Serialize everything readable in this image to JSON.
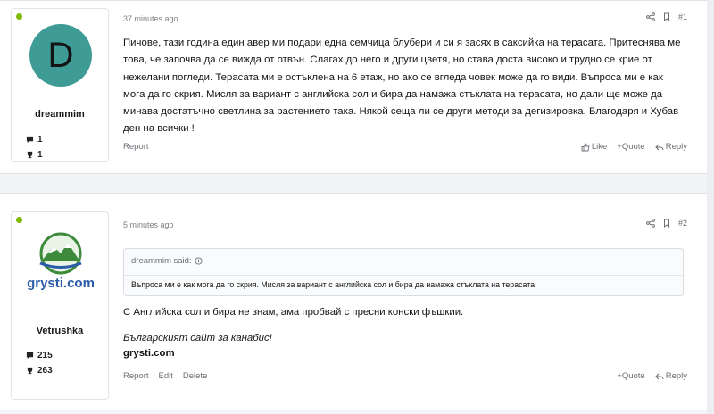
{
  "posts": [
    {
      "time": "37 minutes ago",
      "number": "#1",
      "user": {
        "avatar_letter": "D",
        "name": "dreammim",
        "messages": "1",
        "reactions": "1"
      },
      "body": "Пичове, тази година един авер ми подари една семчица блубери и си я засях в саксийка на терасата. Притеснява ме това, че започва да се вижда от отвън. Слагах до него и други цветя, но става доста високо и трудно се крие от нежелани погледи. Терасата ми е остъклена на 6 етаж, но ако се вгледа човек може да го види. Въпроса ми е как мога да го скрия. Мисля за вариант с английска сол и бира да намажа стъклата на терасата, но дали ще може да минава достатъчно светлина за растението така. Някой сеща ли се други методи за дегизировка. Благодаря и Хубав ден на всички !",
      "footer_left": [
        "Report"
      ],
      "actions": {
        "like": "Like",
        "quote": "+Quote",
        "reply": "Reply"
      }
    },
    {
      "time": "5 minutes ago",
      "number": "#2",
      "user": {
        "logo_text": "grysti.com",
        "name": "Vetrushka",
        "messages": "215",
        "reactions": "263"
      },
      "quote": {
        "author": "dreammim said:",
        "text": "Въпроса ми е как мога да го скрия. Мисля за вариант с английска сол и бира да намажа стъклата на терасата"
      },
      "body": "С Английска сол и бира не знам, ама пробвай с пресни конски фъшкии.",
      "signature": {
        "line1": "Българският сайт за канабис!",
        "line2": "grysti.com"
      },
      "footer_left": [
        "Report",
        "Edit",
        "Delete"
      ],
      "actions": {
        "quote": "+Quote",
        "reply": "Reply"
      }
    }
  ],
  "colors": {
    "avatar_bg": "#3f9b95",
    "online": "#7fb900",
    "logo_green": "#3c8a3a",
    "logo_blue": "#2b5ca8"
  },
  "icons": [
    "share-icon",
    "bookmark-icon",
    "message-icon",
    "trophy-icon",
    "like-icon",
    "reply-icon",
    "expand-icon"
  ]
}
